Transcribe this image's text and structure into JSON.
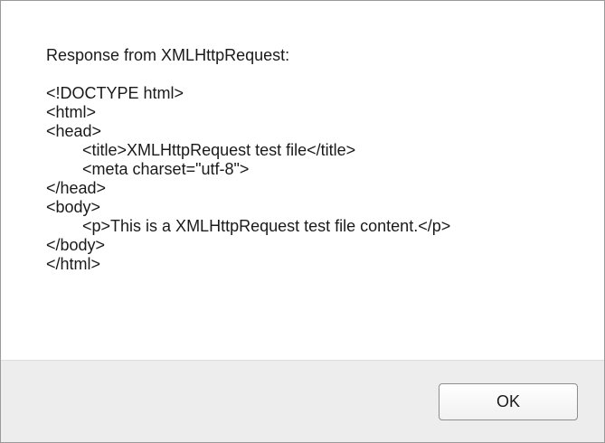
{
  "dialog": {
    "message": "Response from XMLHttpRequest:\n\n<!DOCTYPE html>\n<html>\n<head>\n        <title>XMLHttpRequest test file</title>\n        <meta charset=\"utf-8\">\n</head>\n<body>\n        <p>This is a XMLHttpRequest test file content.</p>\n</body>\n</html>",
    "ok_label": "OK"
  },
  "colors": {
    "footer_background": "#ededed",
    "content_background": "#ffffff",
    "border": "#9a9a9a"
  }
}
